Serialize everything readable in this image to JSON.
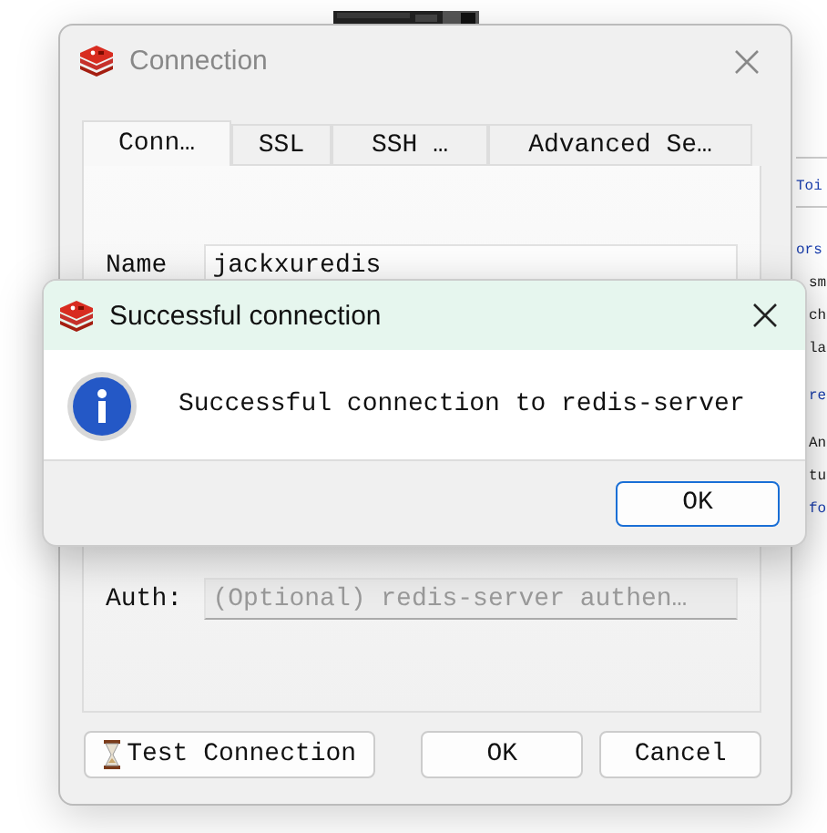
{
  "background_page": {
    "fragments": [
      {
        "text": "Toi",
        "kind": "link"
      },
      {
        "text": "ors",
        "kind": "link"
      },
      {
        "text": "sm",
        "kind": "text"
      },
      {
        "text": "ch",
        "kind": "text"
      },
      {
        "text": "la",
        "kind": "text"
      },
      {
        "text": "re",
        "kind": "link"
      },
      {
        "text": "An",
        "kind": "text"
      },
      {
        "text": "tu",
        "kind": "text"
      },
      {
        "text": "fo",
        "kind": "link"
      }
    ]
  },
  "connection_window": {
    "title": "Connection",
    "tabs": [
      {
        "label": "Conn…",
        "selected": true
      },
      {
        "label": "SSL",
        "selected": false
      },
      {
        "label": "SSH …",
        "selected": false
      },
      {
        "label": "Advanced Se…",
        "selected": false
      }
    ],
    "fields": [
      {
        "label": "Name",
        "value": "jackxuredis",
        "disabled": false
      },
      {
        "label": "Auth:",
        "placeholder": "(Optional) redis-server authen…",
        "disabled": true
      }
    ],
    "buttons": [
      {
        "label": "Test Connection",
        "kind": "test"
      },
      {
        "label": "OK",
        "kind": "plain"
      },
      {
        "label": "Cancel",
        "kind": "plain"
      }
    ]
  },
  "message_box": {
    "title": "Successful connection",
    "message": "Successful connection to redis-server",
    "button": "OK"
  }
}
